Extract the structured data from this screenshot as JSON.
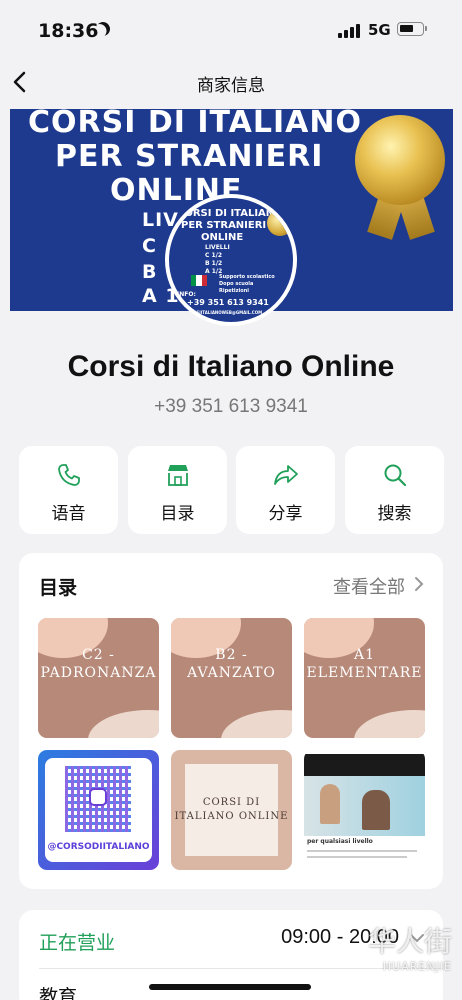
{
  "status_bar": {
    "time": "18:36",
    "network": "5G"
  },
  "nav": {
    "title": "商家信息"
  },
  "banner": {
    "lines": [
      "CORSI DI ITALIANO",
      "PER STRANIERI",
      "ONLINE"
    ],
    "side_letters": [
      "LIV",
      "C",
      "B",
      "A 1"
    ]
  },
  "avatar": {
    "lines": [
      "CORSI DI ITALIANO",
      "PER STRANIERI",
      "ONLINE",
      "LIVELLI",
      "C 1/2",
      "B 1/2",
      "A 1/2"
    ],
    "bullets": [
      "Supporto scolastico",
      "Dopo scuola",
      "Ripetizioni"
    ],
    "info_label": "INFO:",
    "info_phone": "+39 351 613 9341",
    "info_email": "CORSIITALIANOWEB@GMAIL.COM"
  },
  "business": {
    "name": "Corsi di Italiano Online",
    "phone": "+39 351 613 9341"
  },
  "actions": [
    {
      "label": "语音",
      "icon": "phone-icon"
    },
    {
      "label": "目录",
      "icon": "store-icon"
    },
    {
      "label": "分享",
      "icon": "share-icon"
    },
    {
      "label": "搜索",
      "icon": "search-icon"
    }
  ],
  "catalog": {
    "title": "目录",
    "see_all": "查看全部",
    "items": [
      {
        "line1": "C2 -",
        "line2": "PADRONANZA"
      },
      {
        "line1": "B2 -",
        "line2": "AVANZATO"
      },
      {
        "line1": "A1",
        "line2": "ELEMENTARE"
      },
      {
        "handle": "@CORSODIITALIANO"
      },
      {
        "line1": "CORSI DI",
        "line2": "ITALIANO ONLINE"
      },
      {
        "caption": "per qualsiasi livello"
      }
    ]
  },
  "hours": {
    "status": "正在营业",
    "time": "09:00 - 20:00",
    "category": "教育"
  },
  "watermark": {
    "cn": "华人街",
    "en": "HUARENJIE"
  },
  "colors": {
    "accent_green": "#21a05a",
    "banner_blue": "#1e3a8f",
    "tile_brown": "#b78979"
  }
}
